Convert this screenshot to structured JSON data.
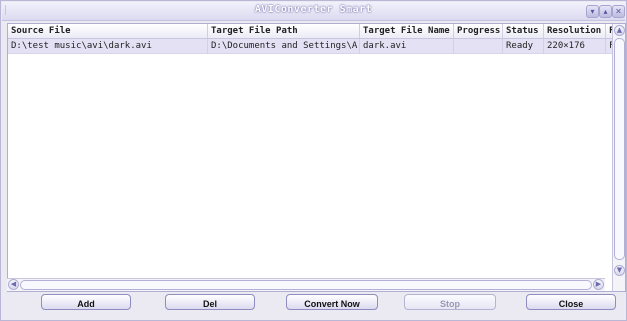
{
  "window": {
    "title": "AVIConverter Smart",
    "controls": {
      "minimize": "▾",
      "maximize": "▴",
      "close": "✕"
    }
  },
  "table": {
    "columns": [
      "Source File",
      "Target File Path",
      "Target File Name",
      "Progress",
      "Status",
      "Resolution",
      "F"
    ],
    "rows": [
      {
        "source_file": "D:\\test music\\avi\\dark.avi",
        "target_file_path": "D:\\Documents and Settings\\A",
        "target_file_name": "dark.avi",
        "progress": "",
        "status": "Ready",
        "resolution": "220×176",
        "extra": "F"
      }
    ]
  },
  "buttons": {
    "add": "Add",
    "del": "Del",
    "convert_now": "Convert Now",
    "stop": "Stop",
    "close": "Close"
  },
  "colors": {
    "selected_row": "#e3e1f3",
    "title_text": "#ffffff",
    "border": "#b9b6d6"
  }
}
